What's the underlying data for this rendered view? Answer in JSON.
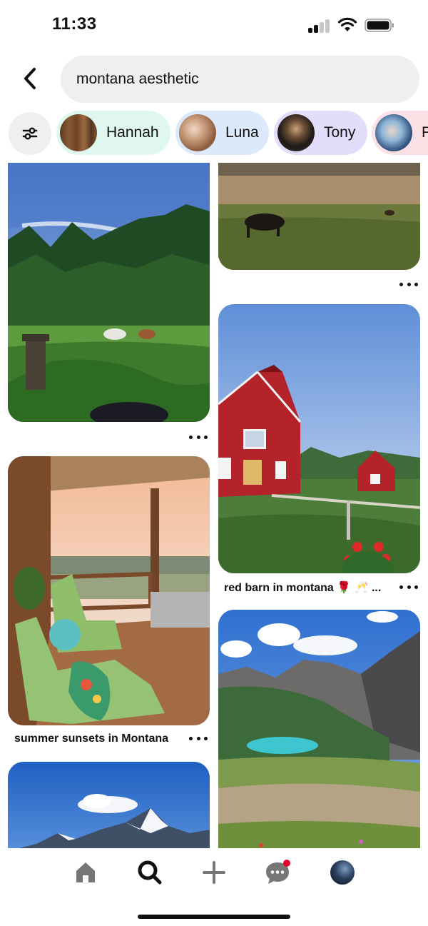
{
  "status_bar": {
    "time": "11:33"
  },
  "search": {
    "query": "montana aesthetic"
  },
  "chips": [
    {
      "label": "Hannah",
      "bg": "#dff7ef"
    },
    {
      "label": "Luna",
      "bg": "#dbe9fb"
    },
    {
      "label": "Tony",
      "bg": "#e4dcfb"
    },
    {
      "label": "F",
      "bg": "#fbe1e6"
    }
  ],
  "pins": [
    {
      "image": "horses-in-meadow-forest",
      "caption": ""
    },
    {
      "image": "horses-grazing-prairie",
      "caption": ""
    },
    {
      "image": "porch-sunset-adirondack-chairs",
      "caption": "summer sunsets in Montana"
    },
    {
      "image": "red-barn-farm",
      "caption": "red barn in montana 🌹 🥂 ..."
    },
    {
      "image": "mountain-lake-glacier-park",
      "caption": ""
    },
    {
      "image": "snowy-mountains-blue-sky",
      "caption": ""
    }
  ],
  "nav": {
    "items": [
      "home-icon",
      "search-icon",
      "add-icon",
      "messages-icon",
      "profile-avatar"
    ],
    "active": "search-icon",
    "notification_color": "#e60023"
  }
}
